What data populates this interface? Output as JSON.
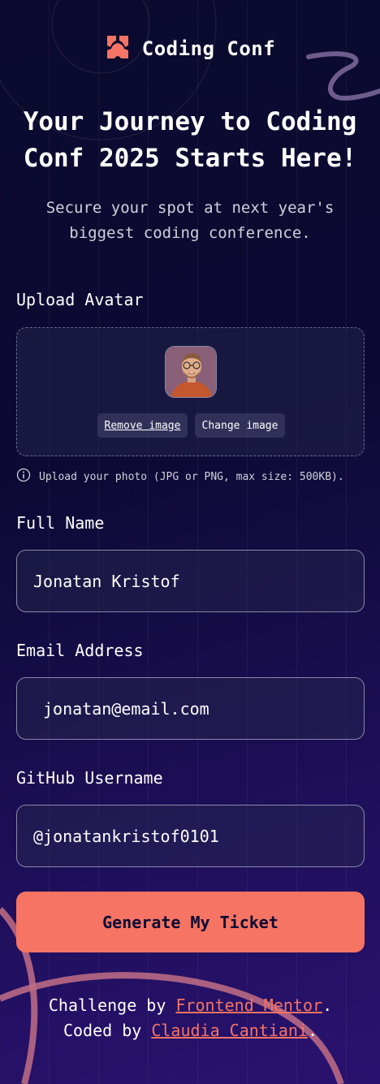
{
  "header": {
    "app_name": "Coding Conf",
    "logo_icon": "coding-conf-logo-icon"
  },
  "hero": {
    "title_line1": "Your Journey to Coding",
    "title_line2": "Conf 2025 Starts Here!",
    "subtitle_line1": "Secure your spot at next year's",
    "subtitle_line2": "biggest coding conference."
  },
  "form": {
    "avatar": {
      "label": "Upload Avatar",
      "remove_label": "Remove image",
      "change_label": "Change image",
      "hint": "Upload your photo (JPG or PNG, max size: 500KB).",
      "hint_icon": "info-icon"
    },
    "full_name": {
      "label": "Full Name",
      "value": "Jonatan Kristof"
    },
    "email": {
      "label": "Email Address",
      "value": "jonatan@email.com"
    },
    "github": {
      "label": "GitHub Username",
      "value": "@jonatankristof0101"
    },
    "submit_label": "Generate My Ticket"
  },
  "footer": {
    "challenge_prefix": "Challenge by",
    "challenge_link": "Frontend Mentor",
    "coded_prefix": "Coded by",
    "coded_link": "Claudia Cantiani",
    "period": "."
  },
  "colors": {
    "accent": "#f57463",
    "background_dark": "#0c0a33",
    "background_purple": "#2a1270",
    "text_muted": "#d1d0db"
  }
}
